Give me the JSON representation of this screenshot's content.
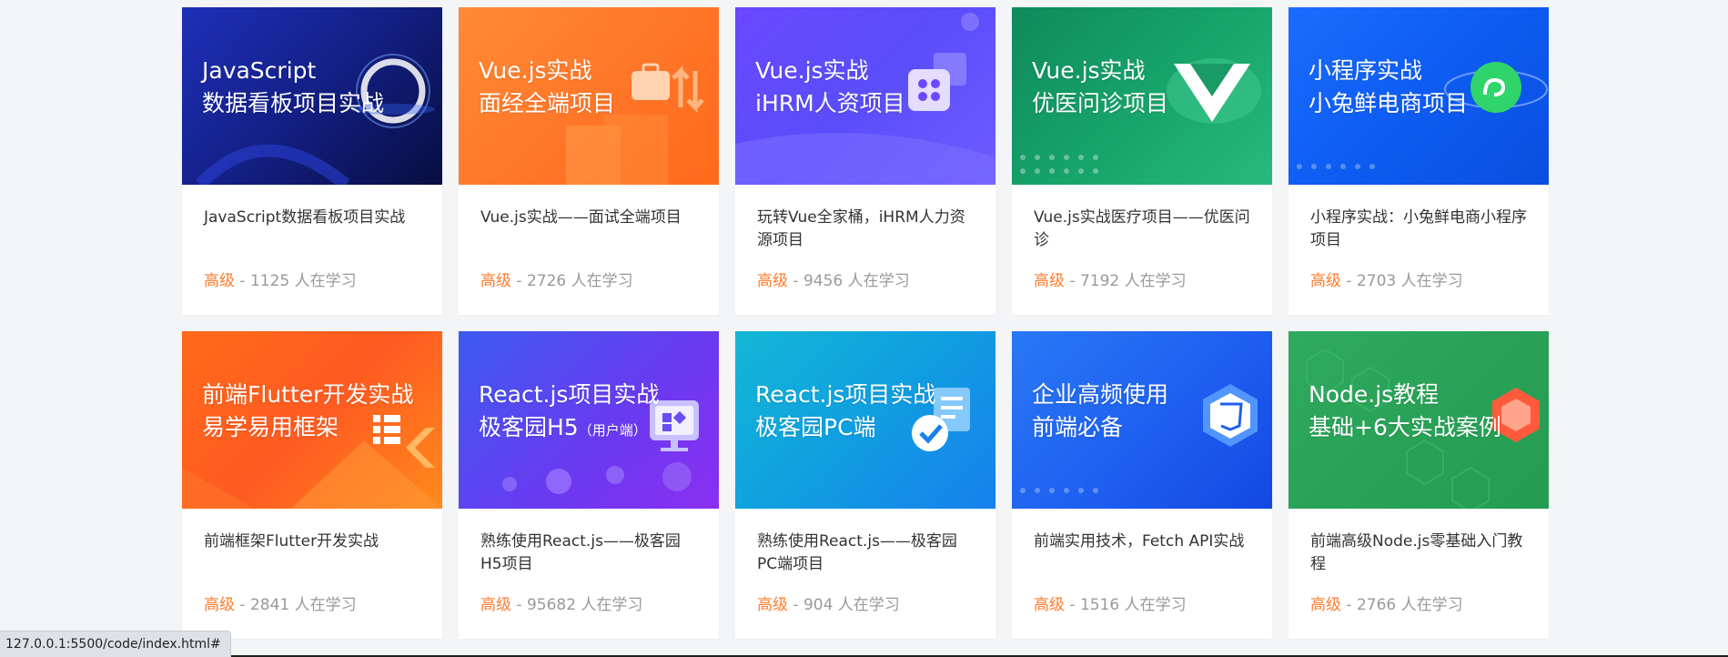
{
  "courses": [
    {
      "cover_line1": "JavaScript",
      "cover_line2": "数据看板项目实战",
      "cover_sub": "",
      "title": "JavaScript数据看板项目实战",
      "level": "高级",
      "learners": " - 1125 人在学习",
      "icon": "ring-icon",
      "accent": "#14218a"
    },
    {
      "cover_line1": "Vue.js实战",
      "cover_line2": "面经全端项目",
      "cover_sub": "",
      "title": "Vue.js实战——面试全端项目",
      "level": "高级",
      "learners": " - 2726 人在学习",
      "icon": "briefcase-icon",
      "accent": "#ff7426"
    },
    {
      "cover_line1": "Vue.js实战",
      "cover_line2": "iHRM人资项目",
      "cover_sub": "",
      "title": "玩转Vue全家桶，iHRM人力资源项目",
      "level": "高级",
      "learners": " - 9456 人在学习",
      "icon": "apps-icon",
      "accent": "#5a4dfa"
    },
    {
      "cover_line1": "Vue.js实战",
      "cover_line2": "优医问诊项目",
      "cover_sub": "",
      "title": "Vue.js实战医疗项目——优医问诊",
      "level": "高级",
      "learners": " - 7192 人在学习",
      "icon": "vue-logo-icon",
      "accent": "#18a56c"
    },
    {
      "cover_line1": "小程序实战",
      "cover_line2": "小兔鲜电商项目",
      "cover_sub": "",
      "title": "小程序实战：小兔鲜电商小程序项目",
      "level": "高级",
      "learners": " - 2703 人在学习",
      "icon": "miniprogram-icon",
      "accent": "#0e5cf2"
    },
    {
      "cover_line1": "前端Flutter开发实战",
      "cover_line2": "易学易用框架",
      "cover_sub": "",
      "title": "前端框架Flutter开发实战",
      "level": "高级",
      "learners": " - 2841 人在学习",
      "icon": "flutter-icon",
      "accent": "#ff5a21"
    },
    {
      "cover_line1": "React.js项目实战",
      "cover_line2": "极客园H5",
      "cover_sub": "（用户端）",
      "title": "熟练使用React.js——极客园H5项目",
      "level": "高级",
      "learners": " - 95682 人在学习",
      "icon": "monitor-icon",
      "accent": "#6b39f0"
    },
    {
      "cover_line1": "React.js项目实战",
      "cover_line2": "极客园PC端",
      "cover_sub": "",
      "title": "熟练使用React.js——极客园PC端项目",
      "level": "高级",
      "learners": " - 904 人在学习",
      "icon": "document-check-icon",
      "accent": "#109ee0"
    },
    {
      "cover_line1": "企业高频使用",
      "cover_line2": "前端必备",
      "cover_sub": "",
      "title": "前端实用技术，Fetch API实战",
      "level": "高级",
      "learners": " - 1516 人在学习",
      "icon": "html5-shield-icon",
      "accent": "#1e5ff0"
    },
    {
      "cover_line1": "Node.js教程",
      "cover_line2": "基础+6大实战案例",
      "cover_sub": "",
      "title": "前端高级Node.js零基础入门教程",
      "level": "高级",
      "learners": " - 2766 人在学习",
      "icon": "nodejs-cube-icon",
      "accent": "#29a257"
    }
  ],
  "status_bar": {
    "url": "127.0.0.1:5500/code/index.html#"
  }
}
